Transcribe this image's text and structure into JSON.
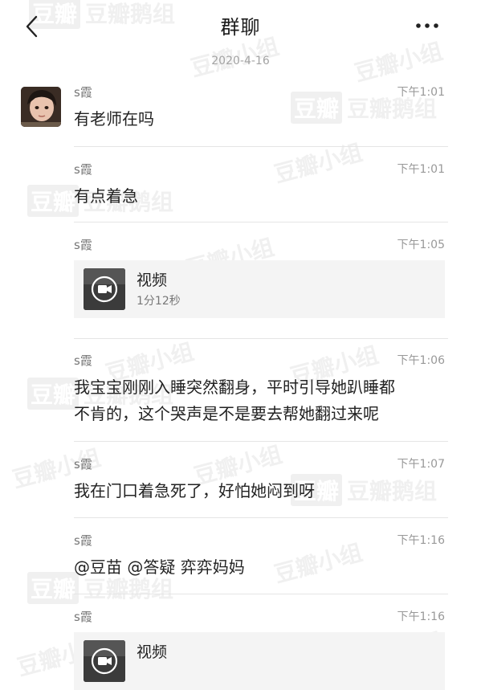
{
  "header": {
    "title": "群聊"
  },
  "date": "2020-4-16",
  "messages": [
    {
      "sender": "s霞",
      "time": "下午1:01",
      "text": "有老师在吗"
    },
    {
      "sender": "s霞",
      "time": "下午1:01",
      "text": "有点着急"
    },
    {
      "sender": "s霞",
      "time": "下午1:05",
      "video": {
        "title": "视频",
        "duration": "1分12秒"
      }
    },
    {
      "sender": "s霞",
      "time": "下午1:06",
      "text_lines": [
        "我宝宝刚刚入睡突然翻身，平时引导她趴睡都",
        "不肯的，这个哭声是不是要去帮她翻过来呢"
      ]
    },
    {
      "sender": "s霞",
      "time": "下午1:07",
      "text": "我在门口着急死了，好怕她闷到呀"
    },
    {
      "sender": "s霞",
      "time": "下午1:16",
      "text": "@豆苗 @答疑 弈弈妈妈"
    },
    {
      "sender": "s霞",
      "time": "下午1:16",
      "video": {
        "title": "视频"
      }
    }
  ],
  "watermarks": {
    "box": "豆瓣",
    "group": "豆瓣鹅组",
    "small": "豆瓣小组"
  },
  "icons": {
    "back": "chevron-left-icon",
    "more": "more-dots-icon",
    "video": "video-camera-icon"
  }
}
